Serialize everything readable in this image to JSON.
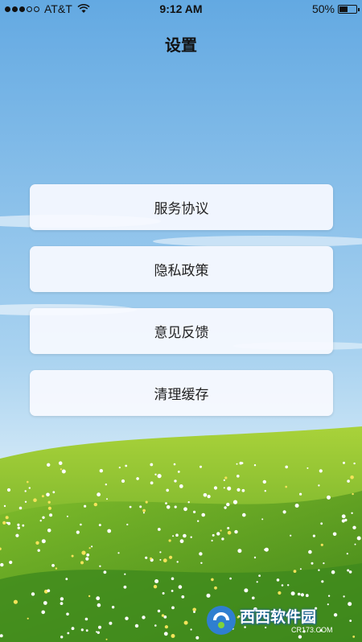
{
  "status_bar": {
    "carrier": "AT&T",
    "time": "9:12 AM",
    "battery_text": "50%",
    "battery_level": 0.5,
    "signal_strength": 3,
    "signal_max": 5
  },
  "header": {
    "title": "设置"
  },
  "menu": {
    "items": [
      {
        "label": "服务协议"
      },
      {
        "label": "隐私政策"
      },
      {
        "label": "意见反馈"
      },
      {
        "label": "清理缓存"
      }
    ]
  },
  "watermark": {
    "brand": "西西软件园",
    "url": "CR173.COM"
  },
  "colors": {
    "sky_top": "#6fb0e3",
    "sky_bottom": "#d8ecf8",
    "grass": "#6fb52c",
    "grass_dark": "#3f8a1d"
  }
}
